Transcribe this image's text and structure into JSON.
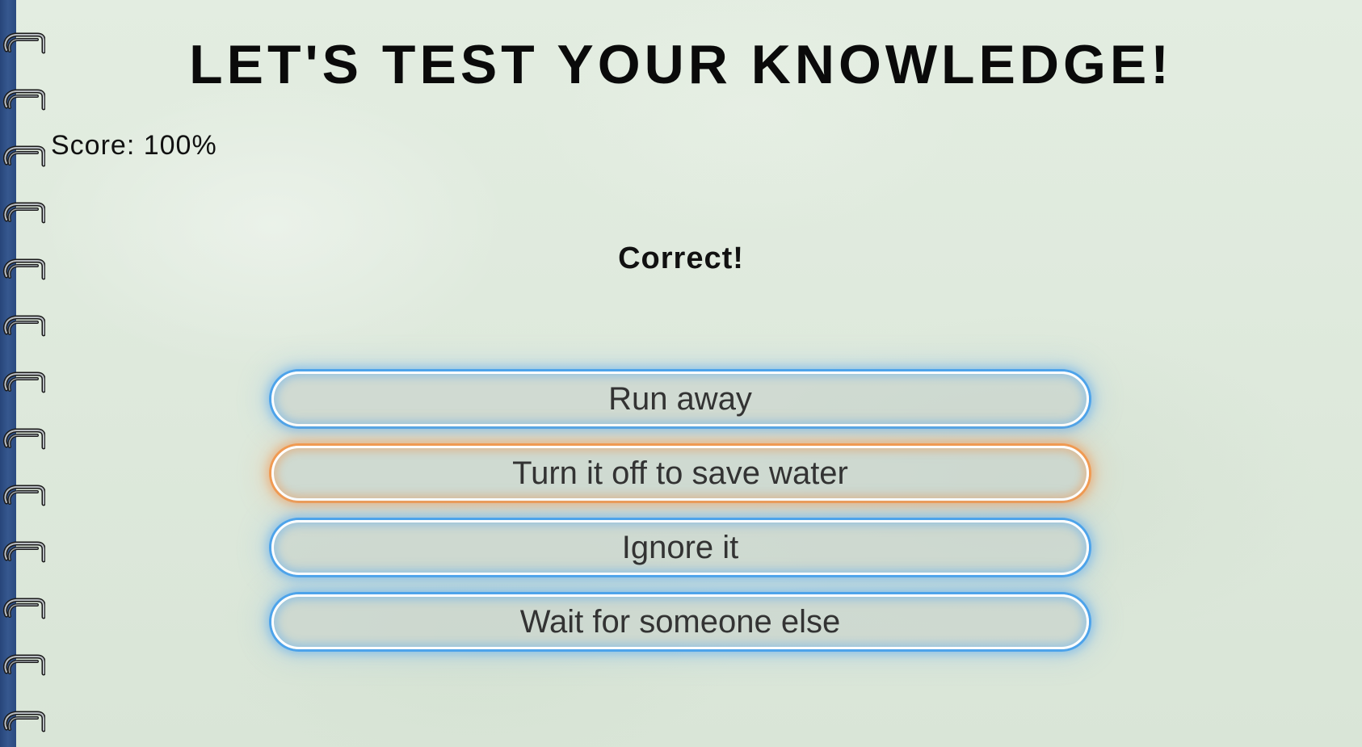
{
  "title": "LET'S TEST YOUR KNOWLEDGE!",
  "score": {
    "text": "Score: 100%"
  },
  "feedback": "Correct!",
  "options": [
    {
      "label": "Run away",
      "state": "default"
    },
    {
      "label": "Turn it off to save water",
      "state": "selected"
    },
    {
      "label": "Ignore it",
      "state": "default"
    },
    {
      "label": "Wait for someone else",
      "state": "default"
    }
  ],
  "colors": {
    "background": "#dfeadd",
    "spine": "#2f5088",
    "option_glow_default": "#4da3ea",
    "option_glow_selected": "#f09a52",
    "text_dark": "#0a0a0a"
  },
  "icons": {
    "binding": "spiral-ring-icon"
  }
}
